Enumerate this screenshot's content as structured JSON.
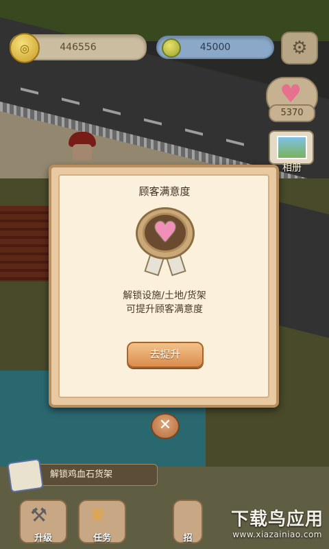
{
  "hud": {
    "coins": "446556",
    "cash": "45000",
    "hearts": "5370",
    "album_label": "相册"
  },
  "modal": {
    "title": "顾客满意度",
    "desc_line1": "解锁设施/土地/货架",
    "desc_line2": "可提升顾客满意度",
    "action_label": "去提升",
    "close_glyph": "✕"
  },
  "task": {
    "text": "解锁鸡血石货架"
  },
  "bottom_nav": {
    "upgrade_label": "升级",
    "mission_label": "任务",
    "hire_label": "招"
  },
  "watermark": {
    "title": "下载鸟应用",
    "url": "www.xiazainiao.com"
  },
  "icons": {
    "coin": "coin-icon",
    "cash": "apple-coin-icon",
    "settings": "gear-icon",
    "heart": "heart-icon",
    "album": "photo-album-icon",
    "medal": "heart-medal-icon",
    "close": "close-icon"
  },
  "colors": {
    "modal_bg": "#fbf0dc",
    "button_orange": "#d98d4d",
    "heart_pink": "#f08fb7"
  }
}
